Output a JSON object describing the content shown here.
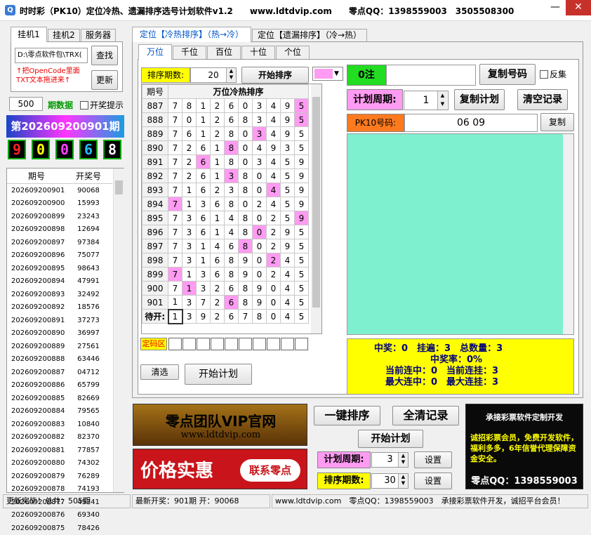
{
  "window": {
    "title": "时时彩（PK10）定位冷热、遗漏排序选号计划软件v1.2　　www.ldtdvip.com　　零点QQ：1398559003　3505508300",
    "icon": "Q",
    "minimize": "—",
    "close": "✕"
  },
  "left": {
    "tabs": [
      "挂机1",
      "挂机2",
      "服务器"
    ],
    "path_value": "D:\\零点软件包\\TRX(",
    "find_label": "查找",
    "update_label": "更新",
    "note": "↑把OpenCode里面TXT文本拖进来↑",
    "count_value": "500",
    "period_data_label": "期数据",
    "open_hint_label": "开奖提示",
    "period_banner": "第202609200901期",
    "digits": [
      "9",
      "0",
      "0",
      "6",
      "8"
    ],
    "digit_colors": [
      "#ff2020",
      "#ffff00",
      "#ff40ff",
      "#20c0ff",
      "#ffffff"
    ],
    "list_header": [
      "期号",
      "开奖号"
    ],
    "rows": [
      [
        "202609200901",
        "90068"
      ],
      [
        "202609200900",
        "15993"
      ],
      [
        "202609200899",
        "23243"
      ],
      [
        "202609200898",
        "12694"
      ],
      [
        "202609200897",
        "97384"
      ],
      [
        "202609200896",
        "75077"
      ],
      [
        "202609200895",
        "98643"
      ],
      [
        "202609200894",
        "47991"
      ],
      [
        "202609200893",
        "32492"
      ],
      [
        "202609200892",
        "18576"
      ],
      [
        "202609200891",
        "37273"
      ],
      [
        "202609200890",
        "36997"
      ],
      [
        "202609200889",
        "27561"
      ],
      [
        "202609200888",
        "63446"
      ],
      [
        "202609200887",
        "04712"
      ],
      [
        "202609200886",
        "65799"
      ],
      [
        "202609200885",
        "82669"
      ],
      [
        "202609200884",
        "79565"
      ],
      [
        "202609200883",
        "10840"
      ],
      [
        "202609200882",
        "82370"
      ],
      [
        "202609200881",
        "77857"
      ],
      [
        "202609200880",
        "74302"
      ],
      [
        "202609200879",
        "76289"
      ],
      [
        "202609200878",
        "74193"
      ],
      [
        "202609200877",
        "45741"
      ],
      [
        "202609200876",
        "69340"
      ],
      [
        "202609200875",
        "78426"
      ]
    ]
  },
  "main": {
    "outer_tabs": [
      "定位【冷热排序】（热→冷）",
      "定位【遗漏排序】（冷→热）"
    ],
    "pos_tabs": [
      "万位",
      "千位",
      "百位",
      "十位",
      "个位"
    ],
    "sort_label": "排序期数:",
    "sort_value": "20",
    "start_sort_label": "开始排序",
    "grid_header": [
      "期号",
      "万位冷热排序"
    ],
    "grid_rows": [
      [
        "887",
        [
          7,
          8,
          1,
          2,
          6,
          0,
          3,
          4,
          9,
          5
        ],
        5
      ],
      [
        "888",
        [
          7,
          0,
          1,
          2,
          6,
          8,
          3,
          4,
          9,
          5
        ],
        5
      ],
      [
        "889",
        [
          7,
          6,
          1,
          2,
          8,
          0,
          3,
          4,
          9,
          5
        ],
        3
      ],
      [
        "890",
        [
          7,
          2,
          6,
          1,
          8,
          0,
          4,
          9,
          3,
          5
        ],
        8
      ],
      [
        "891",
        [
          7,
          2,
          6,
          1,
          8,
          0,
          3,
          4,
          5,
          9
        ],
        6
      ],
      [
        "892",
        [
          7,
          2,
          6,
          1,
          3,
          8,
          0,
          4,
          5,
          9
        ],
        3
      ],
      [
        "893",
        [
          7,
          1,
          6,
          2,
          3,
          8,
          0,
          4,
          5,
          9
        ],
        4
      ],
      [
        "894",
        [
          7,
          1,
          3,
          6,
          8,
          0,
          2,
          4,
          5,
          9
        ],
        7
      ],
      [
        "895",
        [
          7,
          3,
          6,
          1,
          4,
          8,
          0,
          2,
          5,
          9
        ],
        9
      ],
      [
        "896",
        [
          7,
          3,
          6,
          1,
          4,
          8,
          0,
          2,
          9,
          5
        ],
        0
      ],
      [
        "897",
        [
          7,
          3,
          1,
          4,
          6,
          8,
          0,
          2,
          9,
          5
        ],
        8
      ],
      [
        "898",
        [
          7,
          3,
          1,
          6,
          8,
          9,
          0,
          2,
          4,
          5
        ],
        2
      ],
      [
        "899",
        [
          7,
          1,
          3,
          6,
          8,
          9,
          0,
          2,
          4,
          5
        ],
        7
      ],
      [
        "900",
        [
          7,
          1,
          3,
          2,
          6,
          8,
          9,
          0,
          4,
          5
        ],
        1
      ],
      [
        "901",
        [
          1,
          3,
          7,
          2,
          6,
          8,
          9,
          0,
          4,
          5
        ],
        6
      ]
    ],
    "wait_label": "待开:",
    "wait_row": [
      1,
      3,
      9,
      2,
      6,
      7,
      8,
      0,
      4,
      5
    ],
    "dingma_label": "定码区",
    "select_label": "清选",
    "start_plan_label": "开始计划"
  },
  "right": {
    "zero_label": "0注",
    "copy_code_label": "复制号码",
    "reverse_label": "反集",
    "plan_cycle_label": "计划周期:",
    "plan_cycle_value": "1",
    "copy_plan_label": "复制计划",
    "clear_label": "清空记录",
    "pk10_label": "PK10号码:",
    "pk10_value": "06 09",
    "copy_label": "复制",
    "stats": {
      "line1": "中奖：0　挂遍：3　总数量：3",
      "line2": "中奖率：0%",
      "line3": "当前连中：0　当前连挂：3",
      "line4": "最大连中：0　最大连挂：3"
    }
  },
  "bottom": {
    "banner1_title": "零点团队VIP官网",
    "banner1_url": "www.ldtdvip.com",
    "banner2_title": "价格实惠",
    "banner2_badge": "联系零点",
    "one_key_sort": "一键排序",
    "clear_all": "全清记录",
    "start_plan": "开始计划",
    "plan_cycle_label": "计划周期:",
    "plan_cycle_value": "3",
    "sort_label": "排序期数:",
    "sort_value": "30",
    "set_label": "设置",
    "ad_title": "承接彩票软件定制开发",
    "ad_body": "诚招彩票会员，免费开发软件，福利多多，6年信誉代理保障资金安全。",
    "ad_qq": "零点QQ：1398559003"
  },
  "status": {
    "s1": "更新完毕！总共：505期",
    "s2": "最新开奖：901期 开：90068",
    "s3": "www.ldtdvip.com　零点QQ：1398559003　承接彩票软件开发，诚招平台会员！"
  }
}
